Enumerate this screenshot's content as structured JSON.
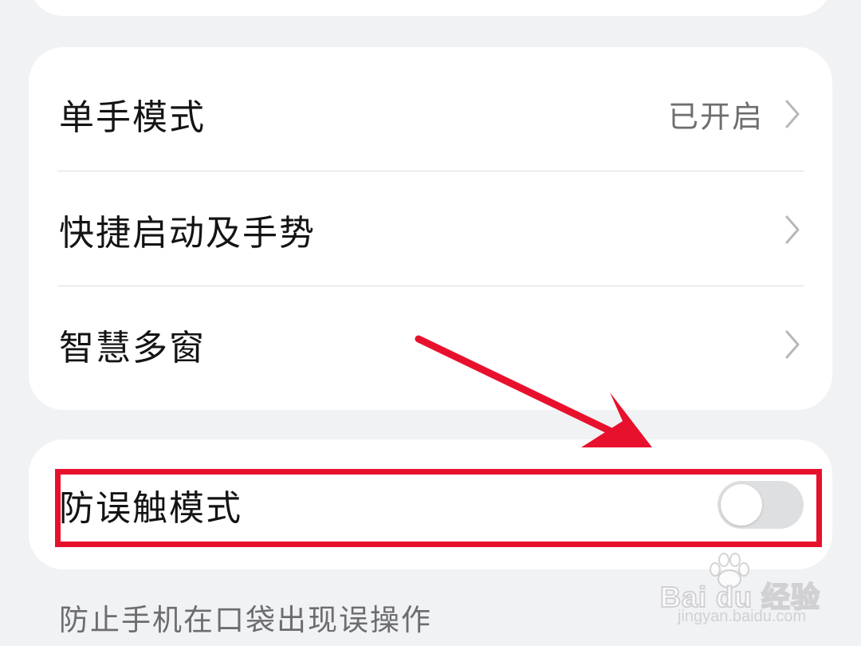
{
  "settings_group": {
    "rows": [
      {
        "label": "单手模式",
        "value": "已开启"
      },
      {
        "label": "快捷启动及手势",
        "value": ""
      },
      {
        "label": "智慧多窗",
        "value": ""
      }
    ]
  },
  "toggle_group": {
    "label": "防误触模式",
    "toggle_on": false
  },
  "footnote": "防止手机在口袋出现误操作",
  "annotation": {
    "color": "#e8112d"
  },
  "watermark": {
    "brand": "Bai du 经验",
    "url": "jingyan.baidu.com"
  },
  "icons": {
    "chevron": "chevron-right-icon",
    "toggle": "toggle-switch",
    "arrow": "annotation-arrow",
    "paw": "baidu-paw-icon"
  },
  "colors": {
    "background": "#f1f2f4",
    "card": "#ffffff",
    "toggle_off": "#dedfe1",
    "annotation_red": "#e8112d"
  }
}
